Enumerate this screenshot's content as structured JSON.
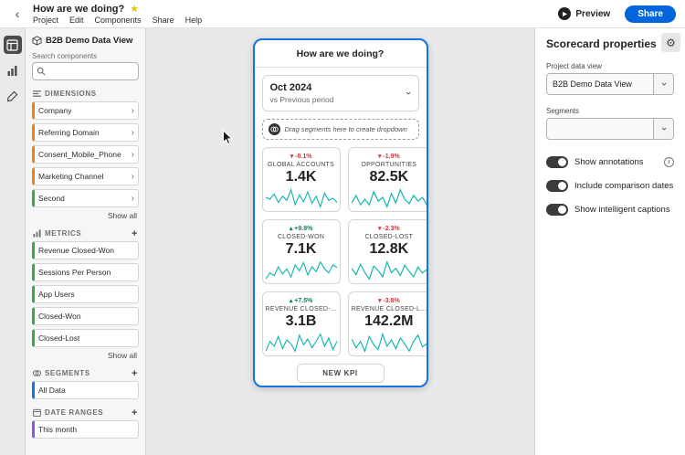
{
  "header": {
    "title": "How are we doing?",
    "menus": [
      "Project",
      "Edit",
      "Components",
      "Share",
      "Help"
    ],
    "preview_label": "Preview",
    "share_label": "Share"
  },
  "sidebar": {
    "dataview": "B2B Demo Data View",
    "search_label": "Search components",
    "dimensions": {
      "title": "Dimensions",
      "show_all": "Show all",
      "items": [
        {
          "label": "Company",
          "color": "#e68619"
        },
        {
          "label": "Referring Domain",
          "color": "#e68619"
        },
        {
          "label": "Consent_Mobile_Phone",
          "color": "#e68619"
        },
        {
          "label": "Marketing Channel",
          "color": "#e68619"
        },
        {
          "label": "Second",
          "color": "#3da74e"
        }
      ]
    },
    "metrics": {
      "title": "Metrics",
      "show_all": "Show all",
      "items": [
        {
          "label": "Revenue Closed-Won",
          "color": "#3da74e"
        },
        {
          "label": "Sessions Per Person",
          "color": "#3da74e"
        },
        {
          "label": "App Users",
          "color": "#3da74e"
        },
        {
          "label": "Closed-Won",
          "color": "#3da74e"
        },
        {
          "label": "Closed-Lost",
          "color": "#3da74e"
        }
      ]
    },
    "segments": {
      "title": "Segments",
      "items": [
        {
          "label": "All Data",
          "color": "#1473e6"
        }
      ]
    },
    "date_ranges": {
      "title": "Date Ranges",
      "items": [
        {
          "label": "This month",
          "color": "#9256d9"
        }
      ]
    }
  },
  "phone": {
    "title": "How are we doing?",
    "period": "Oct 2024",
    "comparison": "vs Previous period",
    "dropzone": "Drag segments here to create dropdown",
    "new_kpi": "NEW KPI",
    "kpis": [
      {
        "label": "GLOBAL ACCOUNTS",
        "value": "1.4K",
        "delta": "▾ -0.1%",
        "spark": [
          52,
          48,
          60,
          40,
          55,
          45,
          70,
          35,
          58,
          42,
          65,
          38,
          55,
          30,
          62,
          45,
          50,
          40
        ]
      },
      {
        "label": "OPPORTUNITIES",
        "value": "82.5K",
        "delta": "▾ -1.9%",
        "spark": [
          40,
          60,
          35,
          50,
          35,
          70,
          45,
          55,
          30,
          65,
          40,
          75,
          50,
          38,
          60,
          45,
          55,
          35
        ]
      },
      {
        "label": "CLOSED-WON",
        "value": "7.1K",
        "delta": "▴ +9.8%",
        "spark": [
          30,
          45,
          38,
          60,
          42,
          55,
          35,
          65,
          50,
          70,
          40,
          60,
          48,
          72,
          55,
          45,
          65,
          58
        ]
      },
      {
        "label": "CLOSED-LOST",
        "value": "12.8K",
        "delta": "▾ -2.3%",
        "spark": [
          55,
          40,
          65,
          45,
          30,
          60,
          50,
          35,
          70,
          45,
          55,
          38,
          62,
          48,
          35,
          58,
          44,
          52
        ]
      },
      {
        "label": "REVENUE CLOSED-...",
        "value": "3.1B",
        "delta": "▴ +7.5%",
        "spark": [
          35,
          55,
          45,
          65,
          40,
          58,
          50,
          35,
          68,
          48,
          60,
          42,
          55,
          70,
          45,
          62,
          38,
          56
        ]
      },
      {
        "label": "REVENUE CLOSED-L...",
        "value": "142.2M",
        "delta": "▾ -3.8%",
        "spark": [
          60,
          42,
          55,
          35,
          65,
          48,
          38,
          70,
          45,
          58,
          40,
          62,
          50,
          35,
          55,
          68,
          44,
          50
        ]
      }
    ]
  },
  "properties": {
    "heading": "Scorecard properties",
    "project_data_view_label": "Project data view",
    "project_data_view_value": "B2B Demo Data View",
    "segments_label": "Segments",
    "segments_value": "",
    "toggles": [
      {
        "label": "Show annotations",
        "on": true
      },
      {
        "label": "Include comparison dates",
        "on": true
      },
      {
        "label": "Show intelligent captions",
        "on": true
      }
    ]
  },
  "colors": {
    "accent": "#1473e6",
    "spark": "#0fb5ae",
    "positive": "#12805c",
    "negative": "#d7373f",
    "star": "#e8c600"
  }
}
